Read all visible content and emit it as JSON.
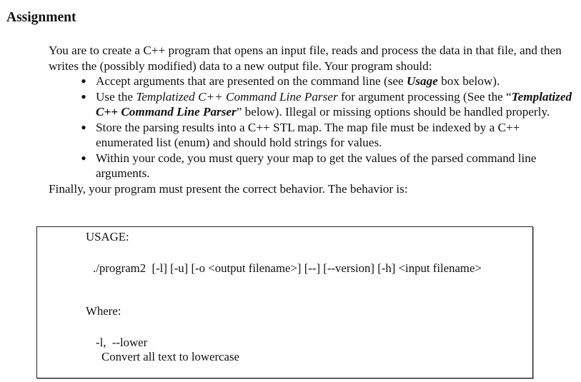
{
  "heading": "Assignment",
  "intro": {
    "paragraph": "You are to create a C++ program that opens an input file, reads and process the data in that file, and then writes the (possibly modified) data to a new output file. Your program should:",
    "bullets": [
      {
        "parts": [
          {
            "text": "Accept arguments that are presented on the command line (see ",
            "style": "normal"
          },
          {
            "text": "Usage",
            "style": "bold-italic"
          },
          {
            "text": " box below).",
            "style": "normal"
          }
        ]
      },
      {
        "parts": [
          {
            "text": "Use the ",
            "style": "normal"
          },
          {
            "text": "Templatized C++ Command Line Parser",
            "style": "italic"
          },
          {
            "text": " for argument processing (See the “",
            "style": "normal"
          },
          {
            "text": "Templatized C++ Command Line Parser",
            "style": "bold-italic"
          },
          {
            "text": "” below).  Illegal or missing options should be handled properly.",
            "style": "normal"
          }
        ]
      },
      {
        "parts": [
          {
            "text": "Store the parsing results into a C++ STL map.  The map file must be indexed by a C++ enumerated list (enum) and should hold strings for values.",
            "style": "normal"
          }
        ]
      },
      {
        "parts": [
          {
            "text": "Within your code, you must query your map to get the values of the parsed command line arguments.",
            "style": "normal"
          }
        ]
      }
    ],
    "closing": "Finally, your program must present the correct behavior.  The behavior is:"
  },
  "usage_box": {
    "title": "USAGE:",
    "command": "./program2  [-l] [-u] [-o <output filename>] [--] [--version] [-h] <input filename>",
    "where_label": "Where:",
    "options": [
      {
        "flag": "-l,  --lower",
        "description": "Convert all text to lowercase"
      }
    ]
  }
}
